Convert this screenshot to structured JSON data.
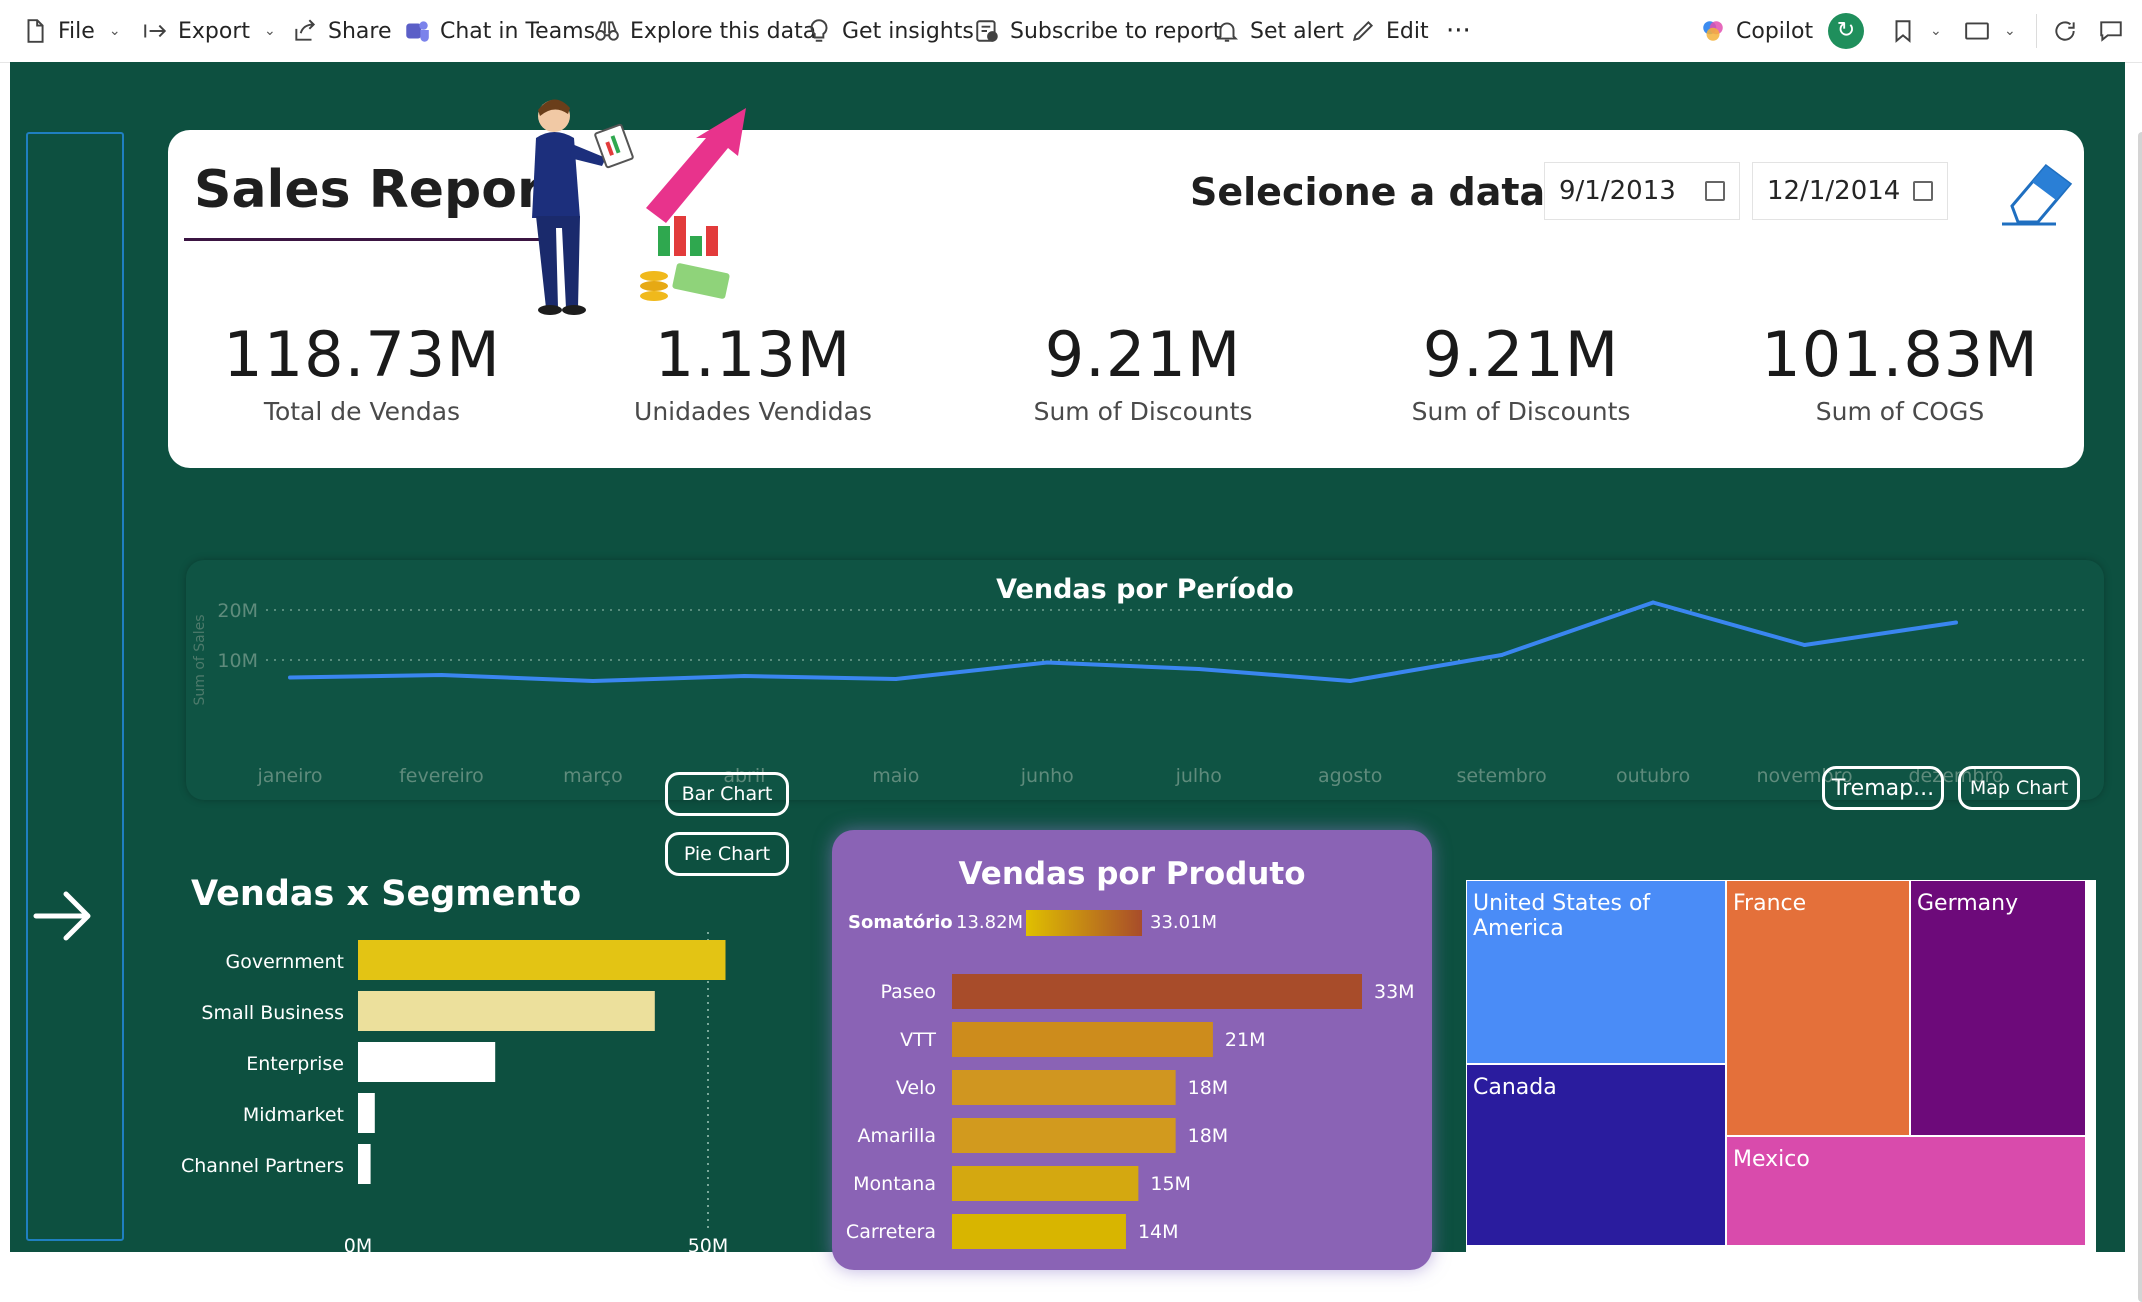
{
  "toolbar": {
    "file": "File",
    "export": "Export",
    "share": "Share",
    "chat_teams": "Chat in Teams",
    "explore": "Explore this data",
    "insights": "Get insights",
    "subscribe": "Subscribe to report",
    "set_alert": "Set alert",
    "edit": "Edit",
    "more": "···",
    "copilot": "Copilot"
  },
  "header": {
    "title": "Sales Report",
    "date_label": "Selecione a data",
    "start_date": "9/1/2013",
    "end_date": "12/1/2014"
  },
  "kpis": [
    {
      "value": "118.73M",
      "label": "Total de Vendas"
    },
    {
      "value": "1.13M",
      "label": "Unidades Vendidas"
    },
    {
      "value": "9.21M",
      "label": "Sum of Discounts"
    },
    {
      "value": "9.21M",
      "label": "Sum of Discounts"
    },
    {
      "value": "101.83M",
      "label": "Sum of COGS"
    }
  ],
  "line_card": {
    "title": "Vendas por Período"
  },
  "segment_card": {
    "title": "Vendas x Segmento",
    "bar_button": "Bar Chart",
    "pie_button": "Pie Chart"
  },
  "product_card": {
    "title": "Vendas por Produto",
    "legend_label": "Somatório",
    "legend_min": "13.82M",
    "legend_max": "33.01M"
  },
  "map_buttons": {
    "treemap": "Tremap...",
    "map": "Map Chart"
  },
  "treemap": [
    {
      "label": "United States of America",
      "color": "#4a8cf7"
    },
    {
      "label": "France",
      "color": "#e4703a"
    },
    {
      "label": "Germany",
      "color": "#6d0a7a"
    },
    {
      "label": "Canada",
      "color": "#2a1c9e"
    },
    {
      "label": "Mexico",
      "color": "#d94bac"
    }
  ],
  "chart_data": [
    {
      "type": "line",
      "title": "Vendas por Período",
      "ylabel": "Sum of Sales",
      "x": [
        "janeiro",
        "fevereiro",
        "março",
        "abril",
        "maio",
        "junho",
        "julho",
        "agosto",
        "setembro",
        "outubro",
        "novembro",
        "dezembro"
      ],
      "y_ticks": [
        "10M",
        "20M"
      ],
      "ylim": [
        0,
        24
      ],
      "series": [
        {
          "values": [
            6.5,
            7.0,
            5.8,
            6.8,
            6.2,
            9.5,
            8.2,
            5.8,
            11.0,
            21.5,
            13.0,
            17.5
          ],
          "color": "#3a86f0"
        }
      ],
      "grid": true
    },
    {
      "type": "bar",
      "title": "Vendas x Segmento",
      "orientation": "horizontal",
      "categories": [
        "Government",
        "Small Business",
        "Enterprise",
        "Midmarket",
        "Channel Partners"
      ],
      "values": [
        52.5,
        42.4,
        19.6,
        2.4,
        1.8
      ],
      "colors": [
        "#e3c414",
        "#ece09c",
        "#ffffff",
        "#ffffff",
        "#ffffff"
      ],
      "x_ticks": [
        "0M",
        "50M"
      ],
      "xlim": [
        0,
        50
      ]
    },
    {
      "type": "bar",
      "title": "Vendas por Produto",
      "orientation": "horizontal",
      "categories": [
        "Paseo",
        "VTT",
        "Velo",
        "Amarilla",
        "Montana",
        "Carretera"
      ],
      "values": [
        33,
        21,
        18,
        18,
        15,
        14
      ],
      "labels": [
        "33M",
        "21M",
        "18M",
        "18M",
        "15M",
        "14M"
      ],
      "colors": [
        "#a84c2a",
        "#cd8c1c",
        "#d09620",
        "#d29a1e",
        "#d4a810",
        "#d8b500"
      ],
      "xlim": [
        0,
        33
      ]
    }
  ]
}
